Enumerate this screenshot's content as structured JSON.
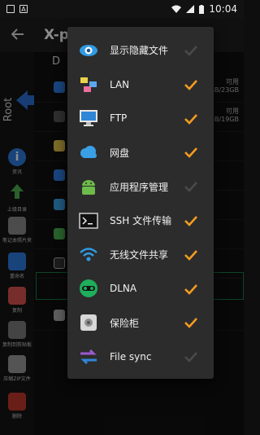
{
  "status_bar": {
    "time": "10:04",
    "icons": [
      "notification-square-icon",
      "text-a-icon",
      "wifi-icon",
      "signal-icon",
      "battery-icon"
    ]
  },
  "app_bar": {
    "title": "X-p",
    "back_icon": "arrow-left-icon"
  },
  "rail": {
    "root_label": "Root",
    "tools": [
      {
        "label": "资讯",
        "icon": "info-icon",
        "color": "#2f7de1"
      },
      {
        "label": "上级目录",
        "icon": "up-arrow-icon",
        "color": "#4caf50"
      },
      {
        "label": "笔记本照片夹",
        "icon": "notebook-icon",
        "color": "#9e9e9e"
      },
      {
        "label": "重命名",
        "icon": "edit-icon",
        "color": "#2f7de1"
      },
      {
        "label": "复制",
        "icon": "copy-icon",
        "color": "#d9534f"
      },
      {
        "label": "复制到剪贴板",
        "icon": "clipboard-icon",
        "color": "#8e8e8e"
      },
      {
        "label": "压缩ZIP文件",
        "icon": "zip-icon",
        "color": "#9e9e9e"
      },
      {
        "label": "删除",
        "icon": "trash-icon",
        "color": "#c0392b"
      }
    ]
  },
  "background_list": {
    "header_letter": "D",
    "storage_rows": [
      {
        "line1": "可用",
        "line2": "GB/23GB"
      },
      {
        "line1": "可用",
        "line2": "GB/19GB"
      }
    ]
  },
  "menu": {
    "items": [
      {
        "label": "显示隐藏文件",
        "icon": "eye-icon",
        "checked": false
      },
      {
        "label": "LAN",
        "icon": "lan-icon",
        "checked": true
      },
      {
        "label": "FTP",
        "icon": "ftp-monitor-icon",
        "checked": true
      },
      {
        "label": "网盘",
        "icon": "cloud-icon",
        "checked": true
      },
      {
        "label": "应用程序管理",
        "icon": "android-icon",
        "checked": false
      },
      {
        "label": "SSH 文件传输",
        "icon": "terminal-icon",
        "checked": true
      },
      {
        "label": "无线文件共享",
        "icon": "wifi-share-icon",
        "checked": true
      },
      {
        "label": "DLNA",
        "icon": "dlna-icon",
        "checked": true
      },
      {
        "label": "保险柜",
        "icon": "safe-icon",
        "checked": true
      },
      {
        "label": "File sync",
        "icon": "sync-arrows-icon",
        "checked": false
      }
    ],
    "check_on_color": "#f39c1f",
    "check_off_color": "#4a4a4a"
  }
}
